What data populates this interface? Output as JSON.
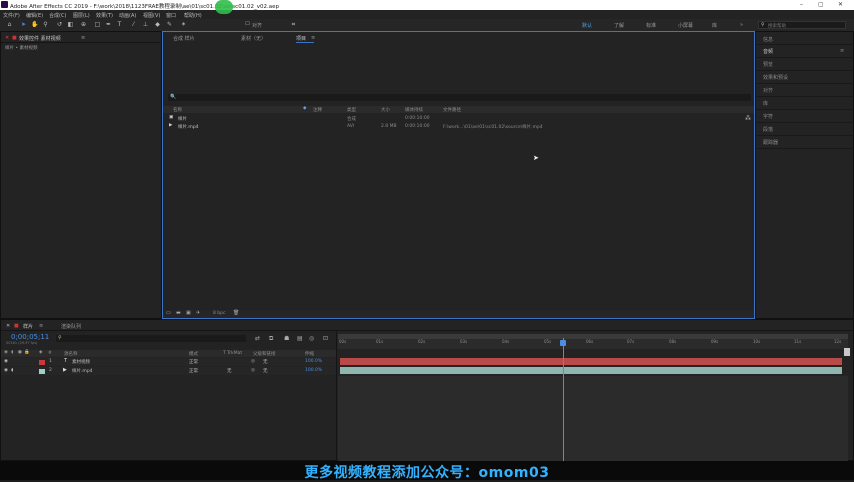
{
  "window": {
    "title": "Adobe After Effects CC 2019 - F:\\work\\2018\\1123FRAE教程录制\\ae\\01\\sc01.02\\ae\\sc01.02_v02.aep",
    "controls": {
      "minimize": "–",
      "maximize": "▢",
      "close": "✕"
    }
  },
  "menu": [
    "文件(F)",
    "编辑(E)",
    "合成(C)",
    "图层(L)",
    "效果(T)",
    "动画(A)",
    "视图(V)",
    "窗口",
    "帮助(H)"
  ],
  "toolbar": {
    "snap_label": "对齐",
    "workspaces": [
      "默认",
      "了解",
      "标准",
      "小屏幕",
      "库"
    ],
    "workspace_more": "»",
    "search_placeholder": "搜索帮助"
  },
  "effects_panel": {
    "tab": "效果控件 素材视频",
    "breadcrumb": "样片 • 素材视频"
  },
  "project_panel": {
    "tabs": [
      "合成 样片",
      "素材（无）",
      "项目"
    ],
    "search_icon": "🔍",
    "columns": {
      "name": "名称",
      "label": "注释",
      "type": "类型",
      "size": "大小",
      "duration": "媒体持续",
      "path": "文件路径"
    },
    "rows": [
      {
        "name": "样片",
        "type": "合成",
        "size": "",
        "duration": "0:00:10:00",
        "path": "",
        "color": "#b0b0b0"
      },
      {
        "name": "样片.mp4",
        "type": "AVI",
        "size": "2.8 MB",
        "duration": "0:00:10:00",
        "path": "F:\\work...\\01\\ae\\01\\sc01.02\\source\\样片.mp4",
        "color": "#7a7a7a"
      }
    ],
    "bpc": "8 bpc"
  },
  "right_panel": {
    "items": [
      "信息",
      "音频",
      "预览",
      "效果和预设",
      "对齐",
      "库",
      "字符",
      "段落",
      "跟踪器"
    ]
  },
  "timeline": {
    "tabs": [
      "样片",
      "渲染队列"
    ],
    "timecode": "0;00;05;11",
    "timecode_sub": "00161 (29.97 fps)",
    "columns": {
      "num": "#",
      "source": "源名称",
      "mode": "模式",
      "trkmat": "T TrkMat",
      "parent": "父级和链接",
      "stretch": "伸缩"
    },
    "layers": [
      {
        "num": "1",
        "icon": "T",
        "name": "素材视频",
        "mode": "正常",
        "trkmat": "",
        "parent": "无",
        "stretch": "100.0%",
        "color": "#c83838"
      },
      {
        "num": "2",
        "icon": "▶",
        "name": "样片.mp4",
        "mode": "正常",
        "trkmat": "无",
        "parent": "无",
        "stretch": "100.0%",
        "color": "#9bd0c8"
      }
    ],
    "ruler_ticks": [
      "00s",
      "01s",
      "02s",
      "03s",
      "04s",
      "05s",
      "06s",
      "07s",
      "08s",
      "09s",
      "10s",
      "11s",
      "12s"
    ],
    "playhead_seconds": 5.37,
    "ruler_max_seconds": 12
  },
  "banner": {
    "text": "更多视频教程添加公众号：omom03"
  }
}
